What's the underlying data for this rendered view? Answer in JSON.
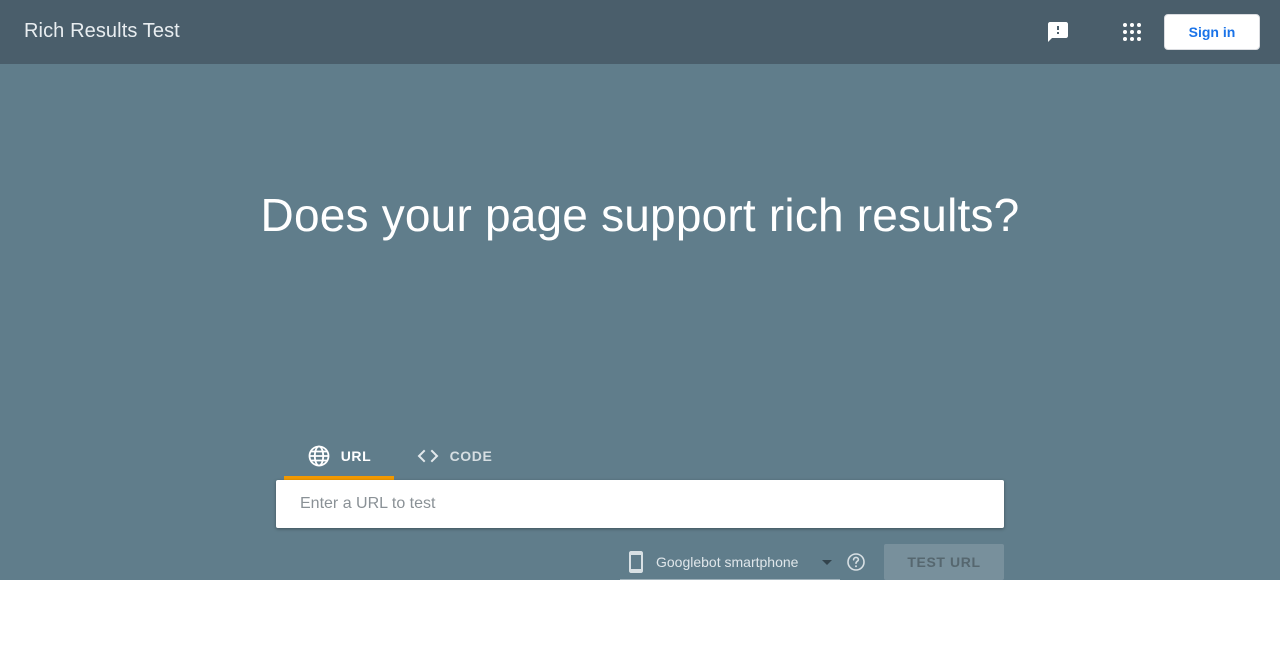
{
  "header": {
    "title": "Rich Results Test",
    "feedback_icon": "feedback-icon",
    "apps_icon": "apps-grid-icon",
    "sign_in_label": "Sign in"
  },
  "hero": {
    "title": "Does your page support rich results?"
  },
  "tabs": [
    {
      "label": "URL",
      "icon": "globe-icon",
      "selected": true
    },
    {
      "label": "CODE",
      "icon": "code-icon",
      "selected": false
    }
  ],
  "url_input": {
    "placeholder": "Enter a URL to test",
    "value": ""
  },
  "device_select": {
    "icon": "smartphone-icon",
    "selected": "Googlebot smartphone"
  },
  "help_icon": "help-circle-icon",
  "test_button": {
    "label": "TEST URL",
    "enabled": false
  },
  "colors": {
    "header_bg": "#4a5e6b",
    "hero_bg": "#607d8b",
    "tab_indicator": "#f29900",
    "sign_in_text": "#1a73e8"
  }
}
